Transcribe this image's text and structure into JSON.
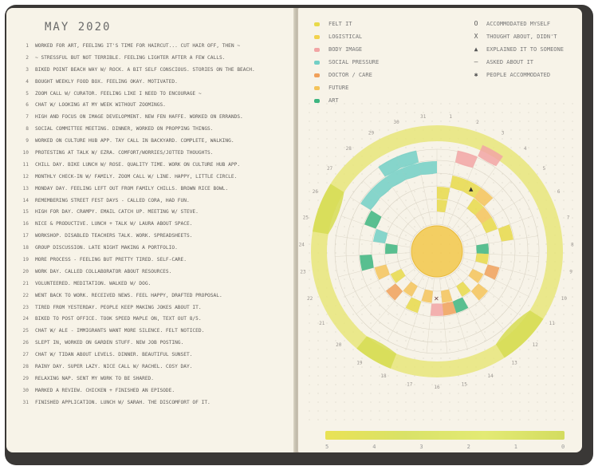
{
  "left_page": {
    "title": "MAY 2020",
    "entries": [
      {
        "day": "1",
        "text": "WORKED FOR ART, FEELING IT'S TIME FOR HAIRCUT... CUT HAIR OFF, THEN ~"
      },
      {
        "day": "2",
        "text": "~ STRESSFUL BUT NOT TERRIBLE. FEELING LIGHTER AFTER A FEW CALLS."
      },
      {
        "day": "3",
        "text": "BIKED POINT BEACH WAY W/ ROCK. A BIT SELF CONSCIOUS. STORIES ON THE BEACH."
      },
      {
        "day": "4",
        "text": "BOUGHT WEEKLY FOOD BOX. FEELING OKAY. MOTIVATED."
      },
      {
        "day": "5",
        "text": "ZOOM CALL W/ CURATOR. FEELING LIKE I NEED TO ENCOURAGE ~"
      },
      {
        "day": "6",
        "text": "CHAT W/ LOOKING AT MY WEEK WITHOUT ZOOMINGS."
      },
      {
        "day": "7",
        "text": "HIGH AND FOCUS ON IMAGE DEVELOPMENT. NEW FEN HAFFE. WORKED ON ERRANDS."
      },
      {
        "day": "8",
        "text": "SOCIAL COMMITTEE MEETING. DINNER, WORKED ON PROPPING THINGS."
      },
      {
        "day": "9",
        "text": "WORKED ON CULTURE HUB APP. TAY CALL IN BACKYARD. COMPLETE, WALKING."
      },
      {
        "day": "10",
        "text": "PROTESTING AT TALK W/ EZRA. COMFORT/WORRIES/JOTTED THOUGHTS."
      },
      {
        "day": "11",
        "text": "CHILL DAY. BIKE LUNCH W/ ROSE. QUALITY TIME. WORK ON CULTURE HUB APP."
      },
      {
        "day": "12",
        "text": "MONTHLY CHECK-IN W/ FAMILY. ZOOM CALL W/ LINE. HAPPY, LITTLE CIRCLE."
      },
      {
        "day": "13",
        "text": "MONDAY DAY. FEELING LEFT OUT FROM FAMILY CHILLS. BROWN RICE BOWL."
      },
      {
        "day": "14",
        "text": "REMEMBERING STREET FEST DAYS - CALLED CORA, HAD FUN."
      },
      {
        "day": "15",
        "text": "HIGH FOR DAY. CRAMPY. EMAIL CATCH UP. MEETING W/ STEVE."
      },
      {
        "day": "16",
        "text": "NICE & PRODUCTIVE. LUNCH + TALK W/ LAURA ABOUT SPACE."
      },
      {
        "day": "17",
        "text": "WORKSHOP. DISABLED TEACHERS TALK. WORK. SPREADSHEETS."
      },
      {
        "day": "18",
        "text": "GROUP DISCUSSION. LATE NIGHT MAKING A PORTFOLIO."
      },
      {
        "day": "19",
        "text": "MORE PROCESS - FEELING BUT PRETTY TIRED. SELF-CARE."
      },
      {
        "day": "20",
        "text": "WORK DAY. CALLED COLLABORATOR ABOUT RESOURCES."
      },
      {
        "day": "21",
        "text": "VOLUNTEERED. MEDITATION. WALKED W/ DOG."
      },
      {
        "day": "22",
        "text": "WENT BACK TO WORK. RECEIVED NEWS. FEEL HAPPY, DRAFTED PROPOSAL."
      },
      {
        "day": "23",
        "text": "TIRED FROM YESTERDAY. PEOPLE KEEP MAKING JOKES ABOUT IT."
      },
      {
        "day": "24",
        "text": "BIKED TO POST OFFICE. TOOK SPEED MAPLE ON, TEXT OUT 8/5."
      },
      {
        "day": "25",
        "text": "CHAT W/ ALE - IMMIGRANTS WANT MORE SILENCE. FELT NOTICED."
      },
      {
        "day": "26",
        "text": "SLEPT IN, WORKED ON GARDEN STUFF. NEW JOB POSTING."
      },
      {
        "day": "27",
        "text": "CHAT W/ TIDAN ABOUT LEVELS. DINNER. BEAUTIFUL SUNSET."
      },
      {
        "day": "28",
        "text": "RAINY DAY. SUPER LAZY. NICE CALL W/ RACHEL. COSY DAY."
      },
      {
        "day": "29",
        "text": "RELAXING NAP. SENT MY WORK TO BE SHARED."
      },
      {
        "day": "30",
        "text": "MARKED A REVIEW. CHICKEN + FINISHED AN EPISODE."
      },
      {
        "day": "31",
        "text": "FINISHED APPLICATION. LUNCH W/ SARAH. THE DISCOMFORT OF IT."
      }
    ]
  },
  "right_page": {
    "legend": [
      {
        "label": "FELT IT",
        "color": "#e8d94a"
      },
      {
        "label": "LOGISTICAL",
        "color": "#f2d24d"
      },
      {
        "label": "BODY IMAGE",
        "color": "#f2a4a4"
      },
      {
        "label": "SOCIAL PRESSURE",
        "color": "#72cfc6"
      },
      {
        "label": "DOCTOR / CARE",
        "color": "#f0a05a"
      },
      {
        "label": "FUTURE",
        "color": "#f4c35a"
      },
      {
        "label": "ART",
        "color": "#3db580"
      }
    ],
    "symbol_key": [
      {
        "symbol": "O",
        "label": "ACCOMMODATED MYSELF"
      },
      {
        "symbol": "X",
        "label": "THOUGHT ABOUT, DIDN'T"
      },
      {
        "symbol": "▲",
        "label": "EXPLAINED IT TO SOMEONE"
      },
      {
        "symbol": "—",
        "label": "ASKED ABOUT IT"
      },
      {
        "symbol": "✱",
        "label": "PEOPLE ACCOMMODATED"
      }
    ],
    "wheel_day_labels": [
      "1",
      "2",
      "3",
      "4",
      "5",
      "6",
      "7",
      "8",
      "9",
      "10",
      "11",
      "12",
      "13",
      "14",
      "15",
      "16",
      "17",
      "18",
      "19",
      "20",
      "21",
      "22",
      "23",
      "24",
      "25",
      "26",
      "27",
      "28",
      "29",
      "30",
      "31"
    ],
    "scale_ticks": [
      "5",
      "4",
      "3",
      "2",
      "1",
      "0"
    ]
  }
}
